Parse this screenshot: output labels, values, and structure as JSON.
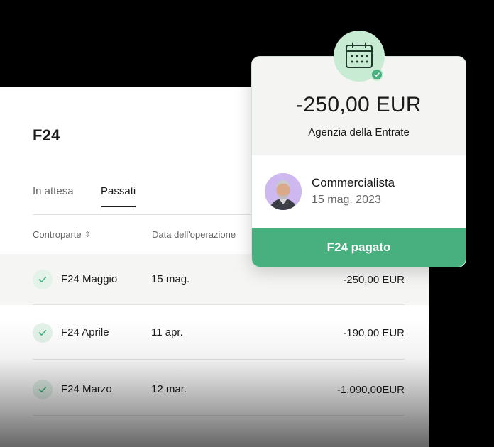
{
  "panel": {
    "title": "F24",
    "tabs": [
      {
        "label": "In attesa"
      },
      {
        "label": "Passati"
      }
    ],
    "columns": {
      "counterparty": "Controparte",
      "date": "Data dell'operazione"
    },
    "rows": [
      {
        "name": "F24 Maggio",
        "date": "15 mag.",
        "amount": "-250,00 EUR"
      },
      {
        "name": "F24 Aprile",
        "date": "11 apr.",
        "amount": "-190,00 EUR"
      },
      {
        "name": "F24 Marzo",
        "date": "12 mar.",
        "amount": "-1.090,00EUR"
      }
    ]
  },
  "card": {
    "amount": "-250,00 EUR",
    "payee": "Agenzia della Entrate",
    "role": "Commercialista",
    "date": "15 mag. 2023",
    "status": "F24 pagato"
  },
  "colors": {
    "accent": "#47b07e",
    "badge": "#c8ebd3",
    "check_bg": "#e3f3ea",
    "avatar_bg": "#cdb8f0"
  }
}
